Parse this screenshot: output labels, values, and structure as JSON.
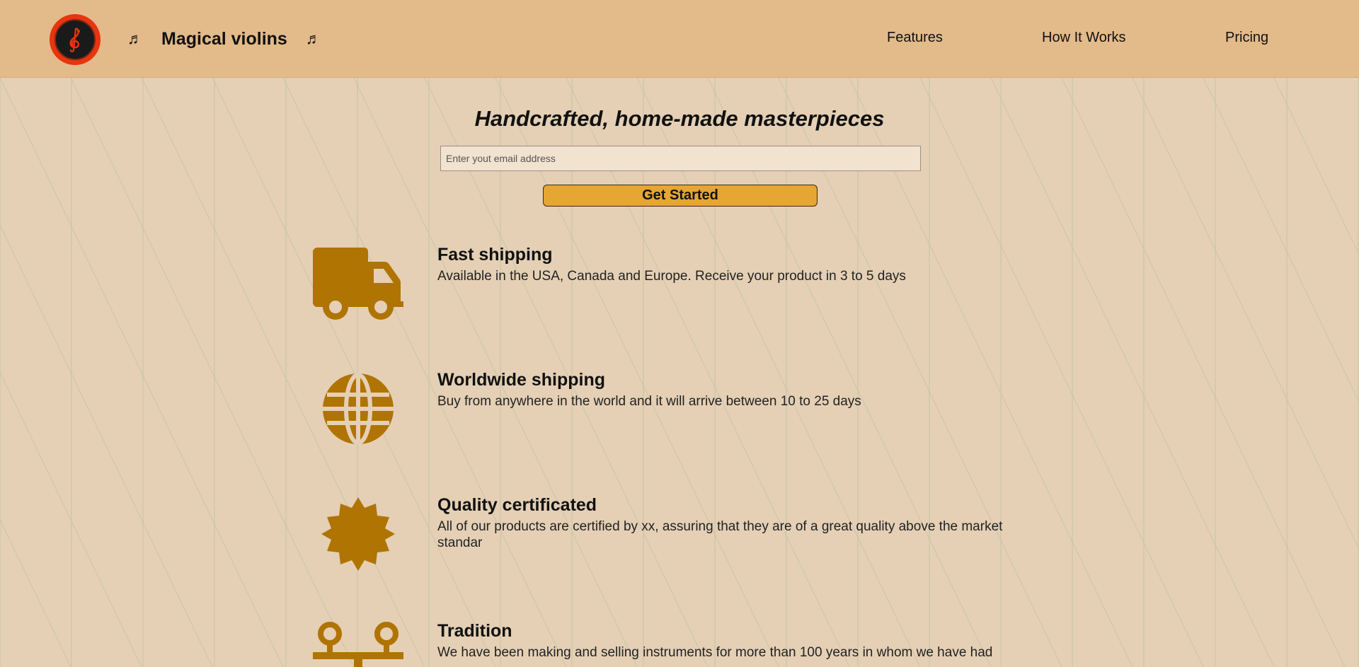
{
  "header": {
    "brand_title": "Magical violins",
    "nav": [
      {
        "label": "Features"
      },
      {
        "label": "How It Works"
      },
      {
        "label": "Pricing"
      }
    ]
  },
  "hero": {
    "title": "Handcrafted, home-made masterpieces",
    "email_placeholder": "Enter yout email address",
    "cta_label": "Get Started"
  },
  "features": [
    {
      "icon": "truck-icon",
      "title": "Fast shipping",
      "desc": "Available in the USA, Canada and Europe. Receive your product in 3 to 5 days"
    },
    {
      "icon": "globe-icon",
      "title": "Worldwide shipping",
      "desc": "Buy from anywhere in the world and it will arrive between 10 to 25 days"
    },
    {
      "icon": "certificate-badge-icon",
      "title": "Quality certificated",
      "desc": "All of our products are certified by xx, assuring that they are of a great quality above the market standar"
    },
    {
      "icon": "scale-icon",
      "title": "Tradition",
      "desc": "We have been making and selling instruments for more than 100 years in whom we have had"
    }
  ],
  "colors": {
    "header_bg": "#e3ba8a",
    "page_bg": "#e5d0b5",
    "accent_button": "#e6a633",
    "icon_color": "#b07403",
    "logo_ring": "#e8340f"
  }
}
